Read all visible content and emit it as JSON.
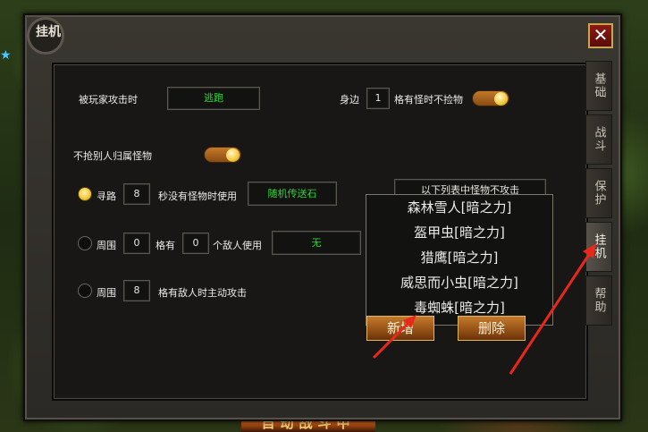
{
  "window": {
    "title": "挂机",
    "close_icon": "✕"
  },
  "tabs": [
    {
      "label": "基础",
      "active": false
    },
    {
      "label": "战斗",
      "active": false
    },
    {
      "label": "保护",
      "active": false
    },
    {
      "label": "挂机",
      "active": true
    },
    {
      "label": "帮助",
      "active": false
    }
  ],
  "settings": {
    "attacked_label": "被玩家攻击时",
    "attacked_action": "逃跑",
    "nearby_label": "身边",
    "nearby_count": "1",
    "nearby_suffix": "格有怪时不捡物",
    "nearby_toggle": true,
    "no_steal_label": "不抢别人归属怪物",
    "no_steal_toggle": true,
    "pathfind_label": "寻路",
    "pathfind_seconds": "8",
    "pathfind_suffix": "秒没有怪物时使用",
    "pathfind_item": "随机传送石",
    "pathfind_selected": true,
    "around_label": "周围",
    "around_cells": "0",
    "around_has": "格有",
    "around_count": "0",
    "around_suffix": "个敌人使用",
    "around_item": "无",
    "around_selected": false,
    "attack_label": "周围",
    "attack_cells": "8",
    "attack_suffix": "格有敌人时主动攻击",
    "attack_selected": false
  },
  "ignore_list": {
    "header": "以下列表中怪物不攻击",
    "items": [
      "森林雪人[暗之力]",
      "盔甲虫[暗之力]",
      "猎鹰[暗之力]",
      "威思而小虫[暗之力]",
      "毒蜘蛛[暗之力]"
    ],
    "add_label": "新增",
    "delete_label": "删除"
  },
  "background": {
    "banner_text": "自动战斗中"
  },
  "colors": {
    "accent_green": "#2fd236",
    "arrow_red": "#e8281c",
    "toggle_knob": "#f0c838"
  }
}
